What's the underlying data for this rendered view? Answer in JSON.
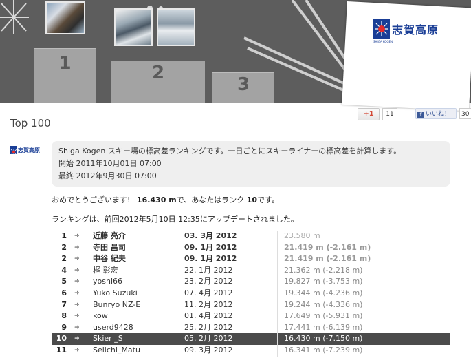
{
  "banner": {
    "podium": [
      {
        "place": "1"
      },
      {
        "place": "2"
      },
      {
        "place": "3"
      }
    ],
    "logo_text": "志賀高原",
    "logo_sub": "SHIGA KOGEN"
  },
  "page_title": "Top 100",
  "social": {
    "gplus_label": "+1",
    "gplus_count": "11",
    "fb_label": "いいね！",
    "fb_count": "30"
  },
  "info": {
    "description": "Shiga Kogen スキー場の標高差ランキングです。一日ごとにスキーライナーの標高差を計算します。",
    "start_label": "開始",
    "start_value": "2011年10月01日 07:00",
    "end_label": "最終",
    "end_value": "2012年9月30日 07:00"
  },
  "congrats": {
    "prefix": "おめでとうございます!",
    "value": "16.430 m",
    "middle": "で、あなたはランク",
    "rank": "10",
    "suffix": "です。"
  },
  "updated_text": "ランキングは、前回2012年5月10日 12:35にアップデートされました。",
  "ranking": [
    {
      "rank": "1",
      "name": "近藤 亮介",
      "date": "03. 3月 2012",
      "height": "23.580 m",
      "style": "top first"
    },
    {
      "rank": "2",
      "name": "寺田 昌司",
      "date": "09. 1月 2012",
      "height": "21.419 m (-2.161 m)",
      "style": "top"
    },
    {
      "rank": "2",
      "name": "中谷 紀夫",
      "date": "09. 1月 2012",
      "height": "21.419 m (-2.161 m)",
      "style": "top"
    },
    {
      "rank": "4",
      "name": "梶 彰宏",
      "date": "22. 1月 2012",
      "height": "21.362 m (-2.218 m)",
      "style": ""
    },
    {
      "rank": "5",
      "name": "yoshi66",
      "date": "23. 2月 2012",
      "height": "19.827 m (-3.753 m)",
      "style": ""
    },
    {
      "rank": "6",
      "name": "Yuko Suzuki",
      "date": "07. 4月 2012",
      "height": "19.344 m (-4.236 m)",
      "style": ""
    },
    {
      "rank": "7",
      "name": "Bunryo NZ-E",
      "date": "11. 2月 2012",
      "height": "19.244 m (-4.336 m)",
      "style": ""
    },
    {
      "rank": "8",
      "name": "kow",
      "date": "01. 4月 2012",
      "height": "17.649 m (-5.931 m)",
      "style": ""
    },
    {
      "rank": "9",
      "name": "userd9428",
      "date": "25. 2月 2012",
      "height": "17.441 m (-6.139 m)",
      "style": ""
    },
    {
      "rank": "10",
      "name": "Skier _S",
      "date": "05. 2月 2012",
      "height": "16.430 m (-7.150 m)",
      "style": "highlight"
    },
    {
      "rank": "11",
      "name": "Seiichi_Matu",
      "date": "09. 3月 2012",
      "height": "16.341 m (-7.239 m)",
      "style": ""
    }
  ],
  "colors": {
    "banner_bg": "#5d5d5d",
    "podium": "#a3a3a3",
    "logo_blue": "#1a3e96",
    "highlight_row": "#4b4b4b"
  }
}
